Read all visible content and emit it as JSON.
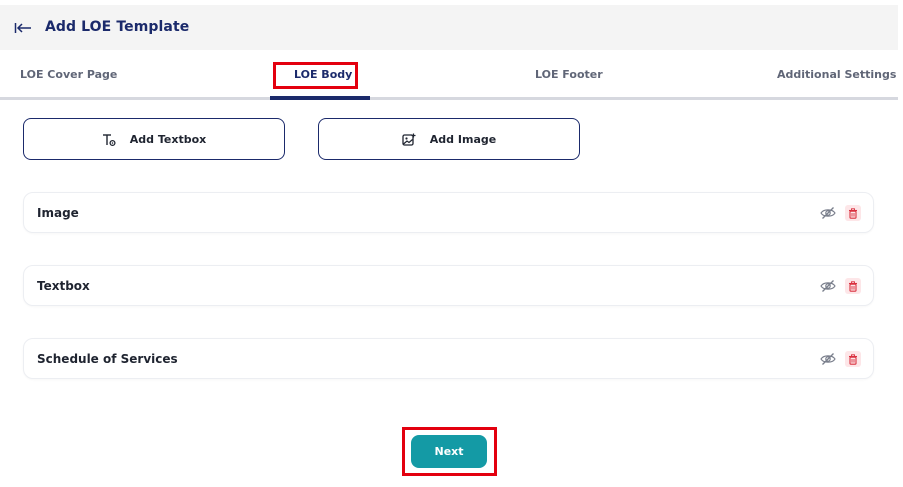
{
  "header": {
    "title": "Add LOE Template",
    "back_icon": "back-arrow-icon"
  },
  "tabs": [
    {
      "label": "LOE Cover Page",
      "active": false
    },
    {
      "label": "LOE Body",
      "active": true
    },
    {
      "label": "LOE Footer",
      "active": false
    },
    {
      "label": "Additional Settings",
      "active": false
    }
  ],
  "actions": {
    "add_textbox": {
      "label": "Add Textbox",
      "icon": "text-format-icon"
    },
    "add_image": {
      "label": "Add Image",
      "icon": "image-add-icon"
    }
  },
  "sections": [
    {
      "label": "Image",
      "visibility_icon": "eye-off-icon",
      "delete_icon": "trash-icon"
    },
    {
      "label": "Textbox",
      "visibility_icon": "eye-off-icon",
      "delete_icon": "trash-icon"
    },
    {
      "label": "Schedule of Services",
      "visibility_icon": "eye-off-icon",
      "delete_icon": "trash-icon"
    }
  ],
  "footer": {
    "next_label": "Next"
  },
  "colors": {
    "primary": "#1b2a6b",
    "accent": "#149aa5",
    "highlight": "#e3000f",
    "danger": "#d9303f",
    "muted": "#606677"
  }
}
